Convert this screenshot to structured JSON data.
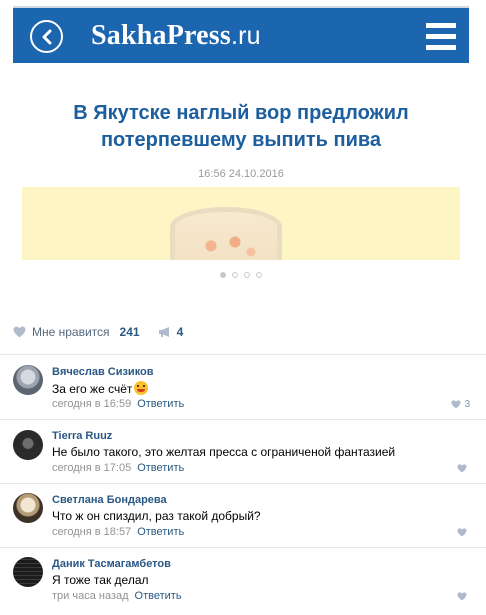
{
  "site": {
    "logo_main": "SakhaPress",
    "logo_tld": ".ru"
  },
  "article": {
    "headline_line1": "В Якутске наглый вор предложил",
    "headline_line2": "потерпевшему выпить пива",
    "date": "16:56 24.10.2016",
    "gallery_count": 4,
    "gallery_active": 1
  },
  "likes": {
    "label": "Мне нравится",
    "count": "241",
    "shares": "4"
  },
  "comments": [
    {
      "author": "Вячеслав Сизиков",
      "text": "За его же счёт",
      "time": "сегодня в 16:59",
      "reply": "Ответить",
      "likes": "3"
    },
    {
      "author": "Tierra Ruuz",
      "text": "Не было такого, это желтая пресса с ограниченой фантазией",
      "time": "сегодня в 17:05",
      "reply": "Ответить",
      "likes": ""
    },
    {
      "author": "Светлана Бондарева",
      "text": "Что ж он спиздил, раз такой добрый?",
      "time": "сегодня в 18:57",
      "reply": "Ответить",
      "likes": ""
    },
    {
      "author": "Даник Тасмагамбетов",
      "text": "Я тоже так делал",
      "time": "три часа назад",
      "reply": "Ответить",
      "likes": ""
    }
  ],
  "colors": {
    "brand_blue": "#1c66b0",
    "headline_blue": "#1c5e9e",
    "link_blue": "#2a5885",
    "muted_gray": "#939393"
  }
}
